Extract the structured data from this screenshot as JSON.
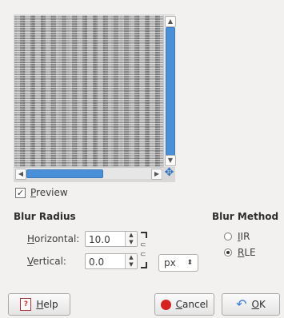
{
  "preview": {
    "checkbox_label": "Preview",
    "checked": true
  },
  "blur_radius": {
    "title": "Blur Radius",
    "horizontal_label": "Horizontal:",
    "horizontal_value": "10.0",
    "vertical_label": "Vertical:",
    "vertical_value": "0.0",
    "unit": "px"
  },
  "blur_method": {
    "title": "Blur Method",
    "options": [
      {
        "label": "IIR",
        "selected": false
      },
      {
        "label": "RLE",
        "selected": true
      }
    ]
  },
  "buttons": {
    "help": "Help",
    "cancel": "Cancel",
    "ok": "OK"
  },
  "icons": [
    "scroll-up-icon",
    "scroll-down-icon",
    "scroll-left-icon",
    "scroll-right-icon",
    "navigate-icon",
    "chain-link-icon",
    "help-icon",
    "cancel-icon",
    "ok-icon"
  ],
  "colors": {
    "accent": "#4a90d9",
    "background": "#f2f1f0"
  }
}
